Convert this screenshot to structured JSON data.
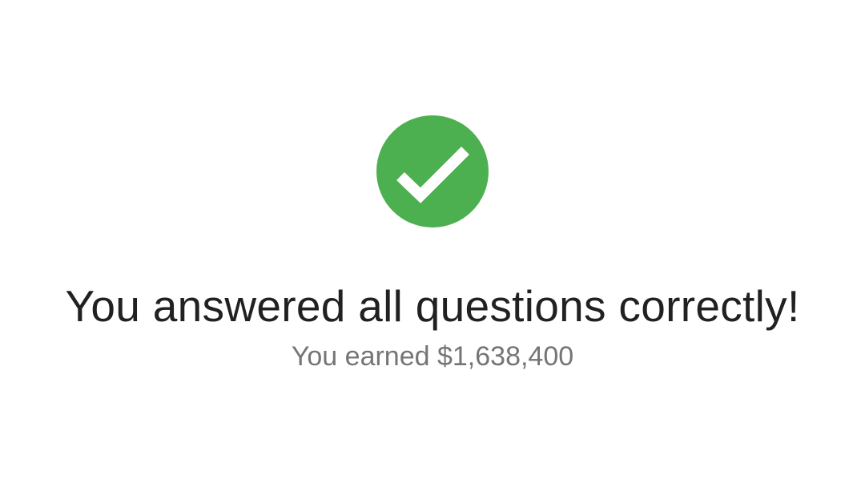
{
  "result": {
    "icon": "check-circle-icon",
    "icon_color": "#4caf50",
    "check_color": "#ffffff",
    "title": "You answered all questions correctly!",
    "subtitle": "You earned $1,638,400"
  },
  "theme": {
    "background": "#ffffff",
    "title_color": "#212121",
    "subtitle_color": "#757575"
  }
}
